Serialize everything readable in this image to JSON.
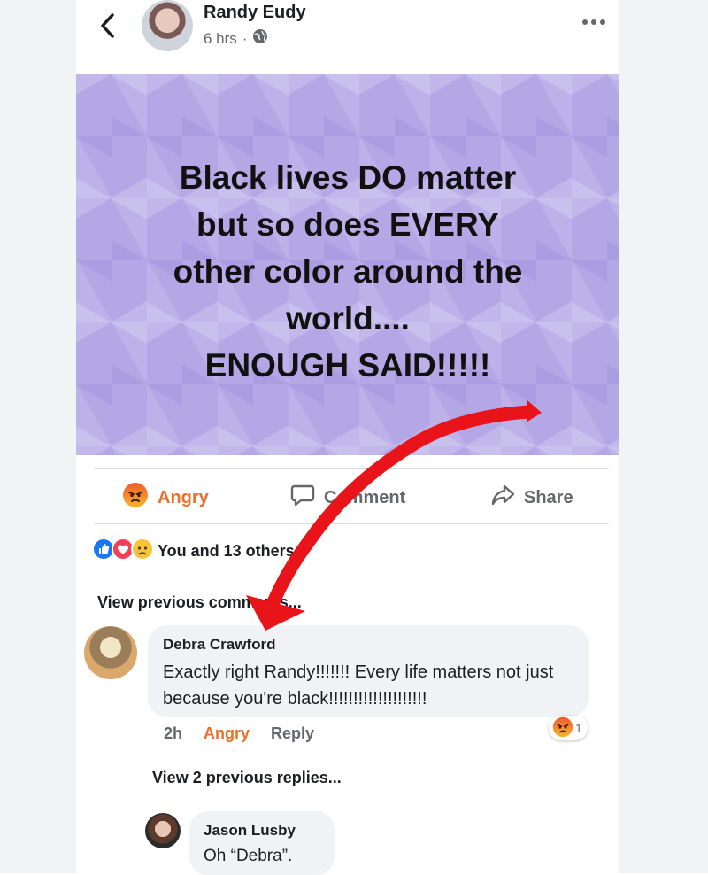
{
  "post": {
    "author": "Randy Eudy",
    "time": "6 hrs",
    "privacy_icon": "globe-icon",
    "image_text": "Black lives DO matter\nbut so does EVERY\nother color around the\nworld....\nENOUGH SAID!!!!!",
    "image_bg_color": "#b3a7e6"
  },
  "actions": {
    "react": "Angry",
    "comment": "Comment",
    "share": "Share"
  },
  "reactions": {
    "summary": "You and 13 others",
    "icons": [
      "like-icon",
      "love-icon",
      "sad-icon"
    ]
  },
  "comments": {
    "view_previous": "View previous comments...",
    "items": [
      {
        "author": "Debra Crawford",
        "text": "Exactly right Randy!!!!!!! Every life matters not just because you're  black!!!!!!!!!!!!!!!!!!!!",
        "time": "2h",
        "react_label": "Angry",
        "reply_label": "Reply",
        "reaction_icon": "angry-icon",
        "reaction_count": "1"
      }
    ],
    "view_replies": "View 2 previous replies...",
    "replies": [
      {
        "author": "Jason Lusby",
        "text": "Oh “Debra”."
      }
    ]
  },
  "colors": {
    "angry": "#e8712b",
    "meta": "#65676b",
    "bubble": "#f0f2f5",
    "annotation_arrow": "#e8141a"
  }
}
